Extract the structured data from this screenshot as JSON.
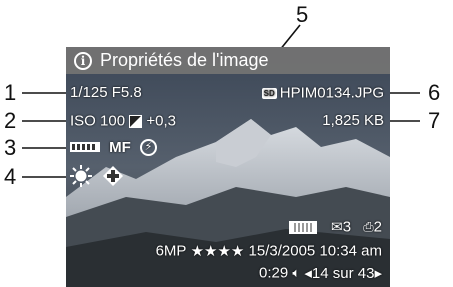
{
  "title": "Propriétés de l'image",
  "title_icon": "info-icon",
  "row1": {
    "shutter_aperture": "1/125 F5.8",
    "sd_badge": "SD",
    "filename": "HPIM0134.JPG"
  },
  "row2": {
    "iso": "ISO 100",
    "ev_icon": "exposure-compensation-icon",
    "ev_value": "+0,3",
    "filesize": "1,825 KB"
  },
  "row3": {
    "metering_icon": "metering-icon",
    "focus": "MF",
    "flash_icon": "flash-icon",
    "flash_symbol": "⚡"
  },
  "row4": {
    "white_balance_icon": "sun-white-balance-icon",
    "adaptive_icon": "adaptive-lighting-icon"
  },
  "status": {
    "prints_icon": "envelope-icon",
    "share_count": "3",
    "print_icon": "print-icon",
    "print_count": "2",
    "bars_icon": "image-quality-bars-icon"
  },
  "info_line": {
    "resolution": "6MP",
    "stars": "★★★★",
    "datetime": "15/3/2005 10:34 am"
  },
  "bottom_line": {
    "duration": "0:29",
    "audio_icon": "speaker-icon",
    "nav": "◂14 sur 43▸"
  },
  "callouts": [
    "1",
    "2",
    "3",
    "4",
    "5",
    "6",
    "7"
  ]
}
